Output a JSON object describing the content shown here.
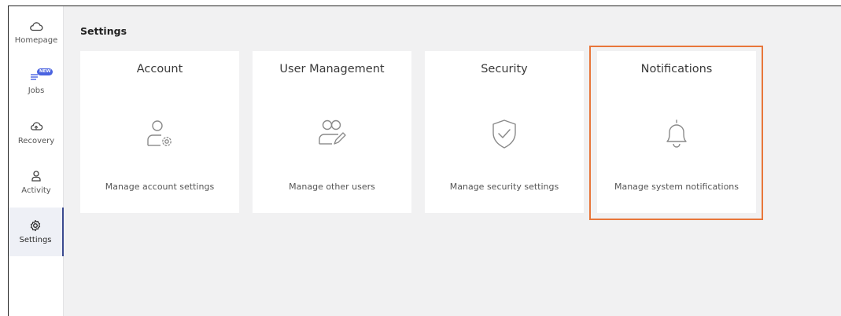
{
  "sidebar": {
    "items": [
      {
        "label": "Homepage",
        "icon": "cloud-icon"
      },
      {
        "label": "Jobs",
        "icon": "jobs-list-icon",
        "badge": "NEW"
      },
      {
        "label": "Recovery",
        "icon": "cloud-recovery-icon"
      },
      {
        "label": "Activity",
        "icon": "user-activity-icon"
      },
      {
        "label": "Settings",
        "icon": "gear-icon",
        "active": true
      }
    ]
  },
  "main": {
    "title": "Settings",
    "cards": [
      {
        "title": "Account",
        "description": "Manage account settings",
        "icon": "user-gear-icon"
      },
      {
        "title": "User Management",
        "description": "Manage other users",
        "icon": "users-edit-icon"
      },
      {
        "title": "Security",
        "description": "Manage security settings",
        "icon": "shield-check-icon"
      },
      {
        "title": "Notifications",
        "description": "Manage system notifications",
        "icon": "bell-icon",
        "highlighted": true
      }
    ]
  },
  "colors": {
    "accent": "#4a63e0",
    "active_border": "#3b4a8f",
    "highlight": "#e8763a",
    "background": "#f1f1f2",
    "icon_stroke": "#8a8a8a"
  }
}
